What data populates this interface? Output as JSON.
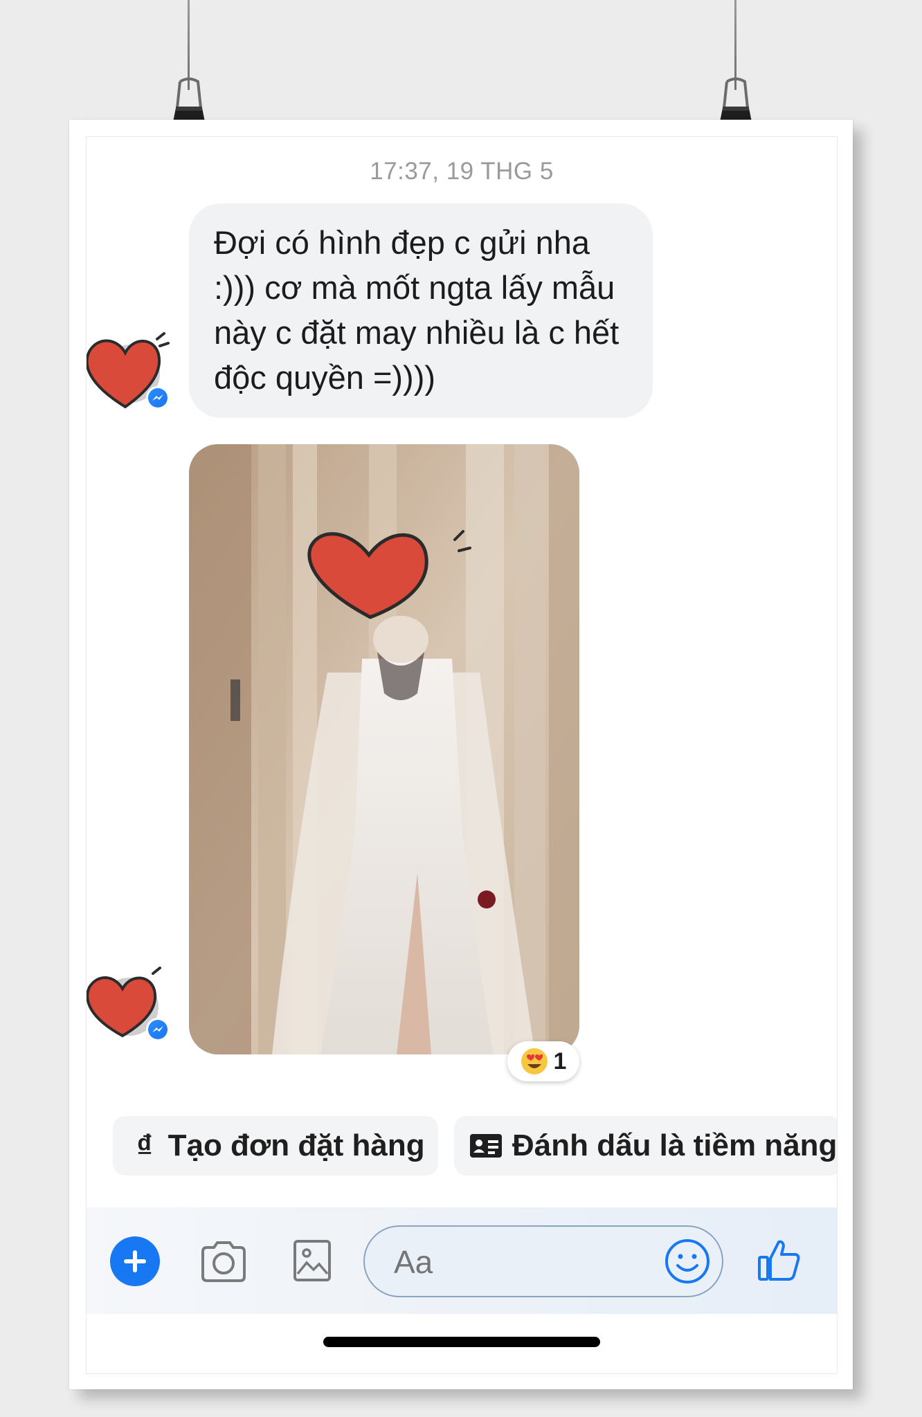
{
  "conversation": {
    "timestamp": "17:37, 19 THG 5",
    "messages": [
      {
        "type": "text",
        "text": "Đợi có hình đẹp c gửi nha :))) cơ mà mốt ngta lấy mẫu này c đặt may nhiều là c hết độc quyền =))))"
      },
      {
        "type": "photo",
        "description_icon": "photo-attachment",
        "reaction": {
          "emoji_icon": "heart-eyes-emoji-icon",
          "count": "1"
        }
      }
    ]
  },
  "quick_actions": [
    {
      "icon": "dong-currency-icon",
      "icon_glyph": "₫",
      "label": "Tạo đơn đặt hàng"
    },
    {
      "icon": "id-card-icon",
      "label": "Đánh dấu là tiềm năng"
    }
  ],
  "composer": {
    "placeholder": "Aa",
    "icons": [
      "add-icon",
      "camera-icon",
      "image-icon",
      "emoji-icon",
      "thumbs-up-icon"
    ]
  },
  "colors": {
    "accent": "#1877f2",
    "bubble": "#f1f2f4",
    "heart": "#d94a3a",
    "composer_border": "#8aa4c0"
  }
}
